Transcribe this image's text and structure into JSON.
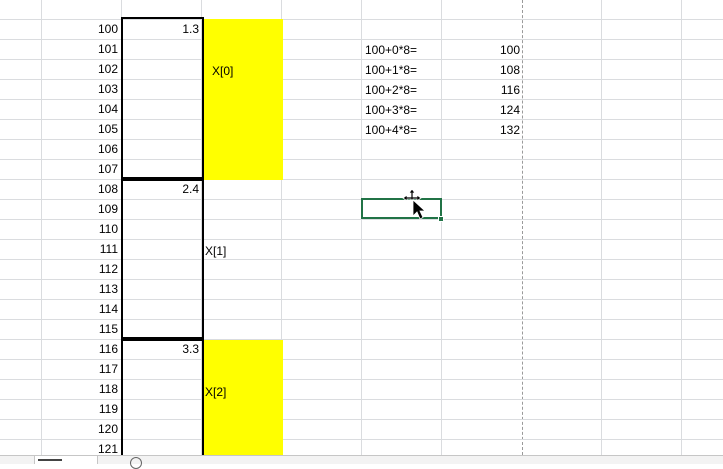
{
  "rows": [
    {
      "row_number": "100",
      "value": "1.3"
    },
    {
      "row_number": "101",
      "value": ""
    },
    {
      "row_number": "102",
      "value": ""
    },
    {
      "row_number": "103",
      "value": ""
    },
    {
      "row_number": "104",
      "value": ""
    },
    {
      "row_number": "105",
      "value": ""
    },
    {
      "row_number": "106",
      "value": ""
    },
    {
      "row_number": "107",
      "value": ""
    },
    {
      "row_number": "108",
      "value": "2.4"
    },
    {
      "row_number": "109",
      "value": ""
    },
    {
      "row_number": "110",
      "value": ""
    },
    {
      "row_number": "111",
      "value": ""
    },
    {
      "row_number": "112",
      "value": ""
    },
    {
      "row_number": "113",
      "value": ""
    },
    {
      "row_number": "114",
      "value": ""
    },
    {
      "row_number": "115",
      "value": ""
    },
    {
      "row_number": "116",
      "value": "3.3"
    },
    {
      "row_number": "117",
      "value": ""
    },
    {
      "row_number": "118",
      "value": ""
    },
    {
      "row_number": "119",
      "value": ""
    },
    {
      "row_number": "120",
      "value": ""
    },
    {
      "row_number": "121",
      "value": ""
    }
  ],
  "array_labels": [
    "X[0]",
    "X[1]",
    "X[2]"
  ],
  "address_calculations": [
    {
      "formula": "100+0*8=",
      "result": "100"
    },
    {
      "formula": "100+1*8=",
      "result": "108"
    },
    {
      "formula": "100+2*8=",
      "result": "116"
    },
    {
      "formula": "100+3*8=",
      "result": "124"
    },
    {
      "formula": "100+4*8=",
      "result": "132"
    }
  ],
  "colors": {
    "highlight": "#ffff00",
    "gridline": "#dadcdf",
    "selection": "#217346",
    "box_border": "#000000"
  },
  "icons": {
    "cursor": "move-cursor-icon",
    "add_sheet": "plus-circle-icon"
  }
}
